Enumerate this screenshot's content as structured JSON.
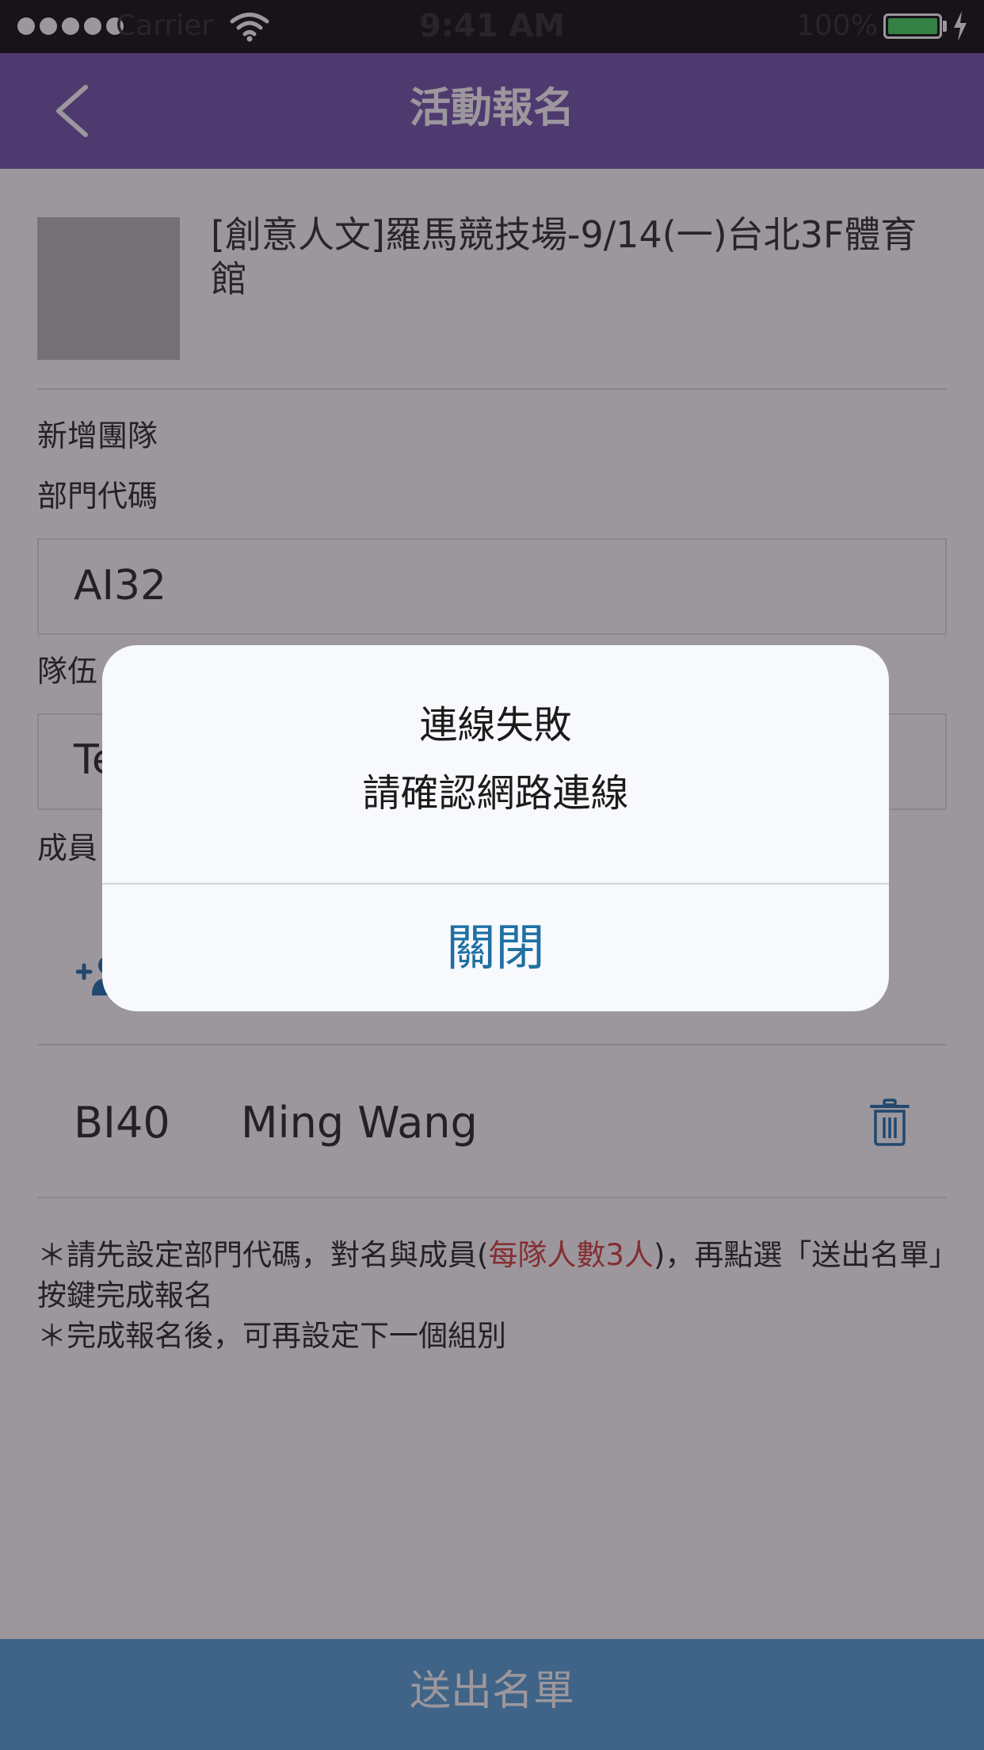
{
  "status_bar": {
    "carrier": "Carrier",
    "time": "9:41 AM",
    "battery": "100%"
  },
  "nav": {
    "title": "活動報名",
    "back_icon": "chevron-left-icon"
  },
  "event": {
    "title": "[創意人文]羅馬競技場-9/14(一)台北3F體育館"
  },
  "form": {
    "section_title": "新增團隊",
    "dept_label": "部門代碼",
    "dept_value": "AI32",
    "team_label": "隊伍",
    "team_value": "Te",
    "member_label": "成員",
    "add_member_icon": "add-user-icon"
  },
  "members": [
    {
      "code": "BI40",
      "name": "Ming Wang",
      "delete_icon": "trash-icon"
    }
  ],
  "notes": {
    "line1_before": "＊請先設定部門代碼，對名與成員(",
    "line1_highlight": "每隊人數3人",
    "line1_after": ")，再點選「送出名單」按鍵完成報名",
    "line2": "＊完成報名後，可再設定下一個組別"
  },
  "submit": {
    "label": "送出名單"
  },
  "dialog": {
    "title": "連線失敗",
    "message": "請確認網路連線",
    "close_label": "關閉"
  },
  "colors": {
    "nav": "#7b5fb0",
    "submit": "#5fa7d9",
    "accent_blue": "#1f6fa3",
    "highlight_red": "#d64a45"
  }
}
